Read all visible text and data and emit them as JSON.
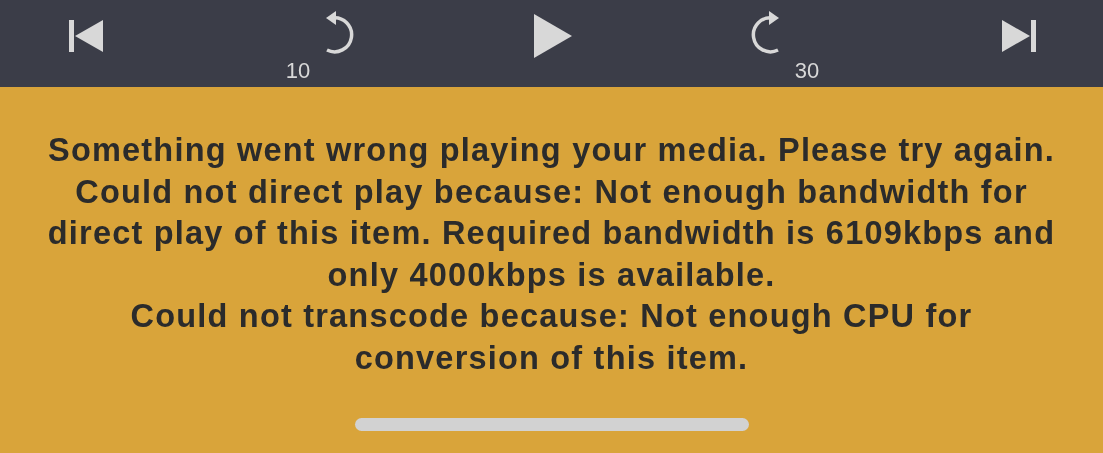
{
  "controls": [
    {
      "kind": "previous"
    },
    {
      "kind": "rewind",
      "label": "10"
    },
    {
      "kind": "play"
    },
    {
      "kind": "forward",
      "label": "30"
    },
    {
      "kind": "next"
    }
  ],
  "error": {
    "lines": [
      "Something went wrong playing your media. Please try again.",
      "Could not direct play because: Not enough bandwidth for",
      "direct play of this item. Required bandwidth is 6109kbps and",
      "only 4000kbps is available.",
      "Could not transcode because: Not enough CPU for",
      "conversion of this item."
    ]
  }
}
